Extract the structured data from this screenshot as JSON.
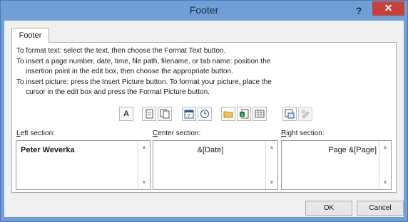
{
  "window": {
    "title": "Footer",
    "help_label": "?",
    "close_label": "✕"
  },
  "tab": {
    "label": "Footer"
  },
  "instructions": [
    "To format text:  select the text, then choose the Format Text button.",
    "To insert a page number, date, time, file path, filename, or tab name:  position the",
    "insertion point in the edit box, then choose the appropriate button.",
    "To insert picture: press the Insert Picture button.  To format your picture, place the",
    "cursor in the edit box and press the Format Picture button."
  ],
  "toolbar": {
    "format_text_label": "A",
    "buttons": [
      "format-text",
      "insert-page-number",
      "insert-number-of-pages",
      "insert-date",
      "insert-time",
      "insert-file-path",
      "insert-file-name",
      "insert-sheet-name",
      "insert-picture",
      "format-picture"
    ]
  },
  "sections": {
    "left": {
      "label_hotkey": "L",
      "label_rest": "eft section:",
      "value": "Peter Weverka"
    },
    "center": {
      "label_hotkey": "C",
      "label_rest": "enter section:",
      "value": "&[Date]"
    },
    "right": {
      "label_hotkey": "R",
      "label_rest": "ight section:",
      "value": "Page &[Page]"
    }
  },
  "buttons": {
    "ok": "OK",
    "cancel": "Cancel"
  },
  "colors": {
    "titlebar": "#6f9fd6",
    "close": "#c7403a",
    "dialog_bg": "#f0f0f0"
  }
}
